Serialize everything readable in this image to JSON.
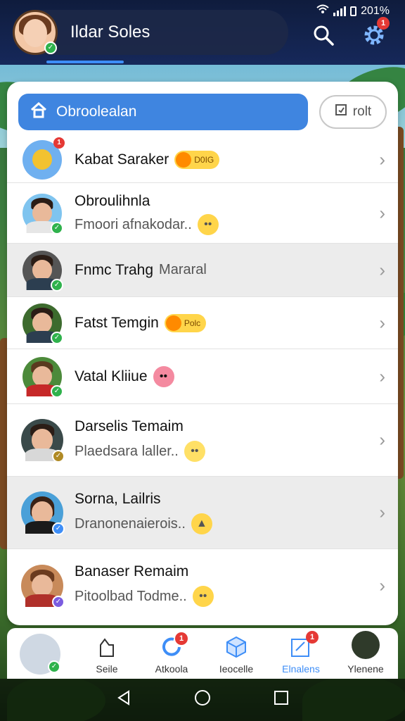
{
  "status_bar": {
    "battery": "201%"
  },
  "header": {
    "title": "Ildar Soles",
    "search_icon": "search-icon",
    "settings_icon": "gear-icon",
    "settings_badge": "1"
  },
  "tabs": {
    "primary_label": "Obroolealan",
    "secondary_label": "rolt"
  },
  "contacts": [
    {
      "name": "Kabat Saraker",
      "tag": "D0IG",
      "badge": "1"
    },
    {
      "name": "Obroulihnla",
      "subtitle": "Fmoori afnakodar.."
    },
    {
      "name": "Fnmc Trahg",
      "name_suffix": "Mararal"
    },
    {
      "name": "Fatst Temgin",
      "tag": "Polc"
    },
    {
      "name": "Vatal Kliiue"
    },
    {
      "name": "Darselis Temaim",
      "subtitle": "Plaedsara laller.."
    },
    {
      "name": "Sorna, Lailris",
      "subtitle": "Dranonenaierois.."
    },
    {
      "name": "Banaser Remaim",
      "subtitle": "Pitoolbad Todme.."
    }
  ],
  "bottom_nav": [
    {
      "label": "Seile"
    },
    {
      "label": "Atkoola",
      "badge": "1"
    },
    {
      "label": "Ieocelle"
    },
    {
      "label": "Elnalens",
      "badge": "1"
    },
    {
      "label": "Ylenene"
    }
  ],
  "colors": {
    "accent": "#3f85e0",
    "header_bg": "#0f1c3d",
    "verified": "#2fb24c",
    "alert": "#e53935"
  }
}
